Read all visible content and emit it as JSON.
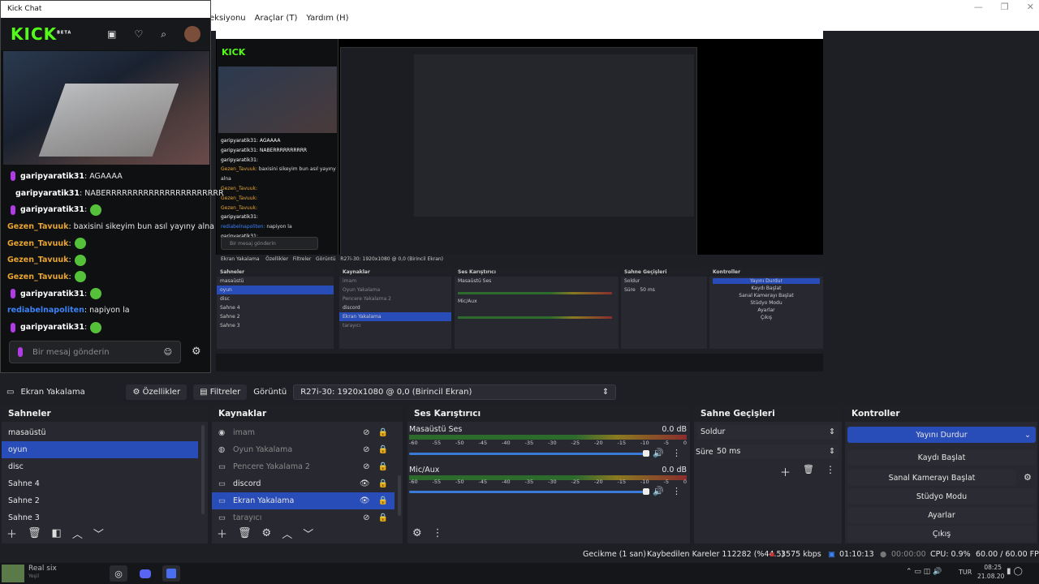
{
  "menu": {
    "items": [
      "eksiyonu",
      "Araçlar (T)",
      "Yardım (H)"
    ]
  },
  "window_controls": [
    "—",
    "❐",
    "✕"
  ],
  "kick_chat": {
    "title": "Kick Chat",
    "logo": "KICK",
    "logo_badge": "BETA",
    "messages": [
      {
        "user": "garipyaratik31",
        "text": ": AGAAAA",
        "style": "p",
        "badge": true
      },
      {
        "user": "garipyaratik31",
        "text": ": NABERRRRRRRRRRRRRRRRRRRRRR",
        "style": "p",
        "badge": true
      },
      {
        "user": "garipyaratik31",
        "text": ":",
        "style": "p",
        "badge": true,
        "emote": true
      },
      {
        "user": "Gezen_Tavuuk",
        "text": ": baxisini sikeyim bun asıl yayıny alna",
        "style": "g"
      },
      {
        "user": "Gezen_Tavuuk",
        "text": ":",
        "style": "g",
        "emote": true
      },
      {
        "user": "Gezen_Tavuuk",
        "text": ":",
        "style": "g",
        "emote": true
      },
      {
        "user": "Gezen_Tavuuk",
        "text": ":",
        "style": "g",
        "emote": true
      },
      {
        "user": "garipyaratik31",
        "text": ":",
        "style": "p",
        "badge": true,
        "emote": true
      },
      {
        "user": "rediabelnapoliten",
        "text": ": napiyon la",
        "style": "b"
      },
      {
        "user": "garipyaratik31",
        "text": ":",
        "style": "p",
        "badge": true,
        "emote": true
      }
    ],
    "input_placeholder": "Bir mesaj gönderin"
  },
  "source_bar": {
    "source_name": "Ekran Yakalama",
    "properties": "Özellikler",
    "filters": "Filtreler",
    "display_label": "Görüntü",
    "display_value": "R27i-30: 1920x1080 @ 0,0 (Birincil Ekran)"
  },
  "scenes": {
    "title": "Sahneler",
    "items": [
      "masaüstü",
      "oyun",
      "disc",
      "Sahne 4",
      "Sahne 2",
      "Sahne 3"
    ],
    "selected": 1
  },
  "sources": {
    "title": "Kaynaklar",
    "items": [
      {
        "label": "imam",
        "dim": true
      },
      {
        "label": "Oyun Yakalama",
        "dim": true
      },
      {
        "label": "Pencere Yakalama 2",
        "dim": true
      },
      {
        "label": "discord",
        "dim": false
      },
      {
        "label": "Ekran Yakalama",
        "dim": false,
        "selected": true
      },
      {
        "label": "tarayıcı",
        "dim": true
      }
    ]
  },
  "mixer": {
    "title": "Ses Karıştırıcı",
    "channels": [
      {
        "name": "Masaüstü Ses",
        "db": "0.0 dB"
      },
      {
        "name": "Mic/Aux",
        "db": "0.0 dB"
      }
    ],
    "scale": [
      "-60",
      "-55",
      "-50",
      "-45",
      "-40",
      "-35",
      "-30",
      "-25",
      "-20",
      "-15",
      "-10",
      "-5",
      "0"
    ]
  },
  "transitions": {
    "title": "Sahne Geçişleri",
    "type": "Soldur",
    "duration_label": "Süre",
    "duration_value": "50 ms"
  },
  "controls": {
    "title": "Kontroller",
    "stop_stream": "Yayını Durdur",
    "start_recording": "Kaydı Başlat",
    "virtual_cam": "Sanal Kamerayı Başlat",
    "studio_mode": "Stüdyo Modu",
    "settings": "Ayarlar",
    "exit": "Çıkış"
  },
  "status": {
    "delay": "Gecikme (1 san)",
    "dropped": "Kaybedilen Kareler 112282 (%44.5)",
    "bitrate": "3575 kbps",
    "stream_time": "01:10:13",
    "rec_time": "00:00:00",
    "cpu": "CPU: 0.9%",
    "fps": "60.00 / 60.00 FPS"
  },
  "taskbar": {
    "user": "Real six",
    "user_sub": "Yeşil",
    "lang": "TUR",
    "time": "08:25",
    "date": "21.08.20"
  },
  "colors": {
    "accent": "#284cb8",
    "kick_green": "#53fc18",
    "badge_purple": "#b13ce6",
    "user_gold": "#e8a431",
    "user_blue": "#3b82f6"
  }
}
